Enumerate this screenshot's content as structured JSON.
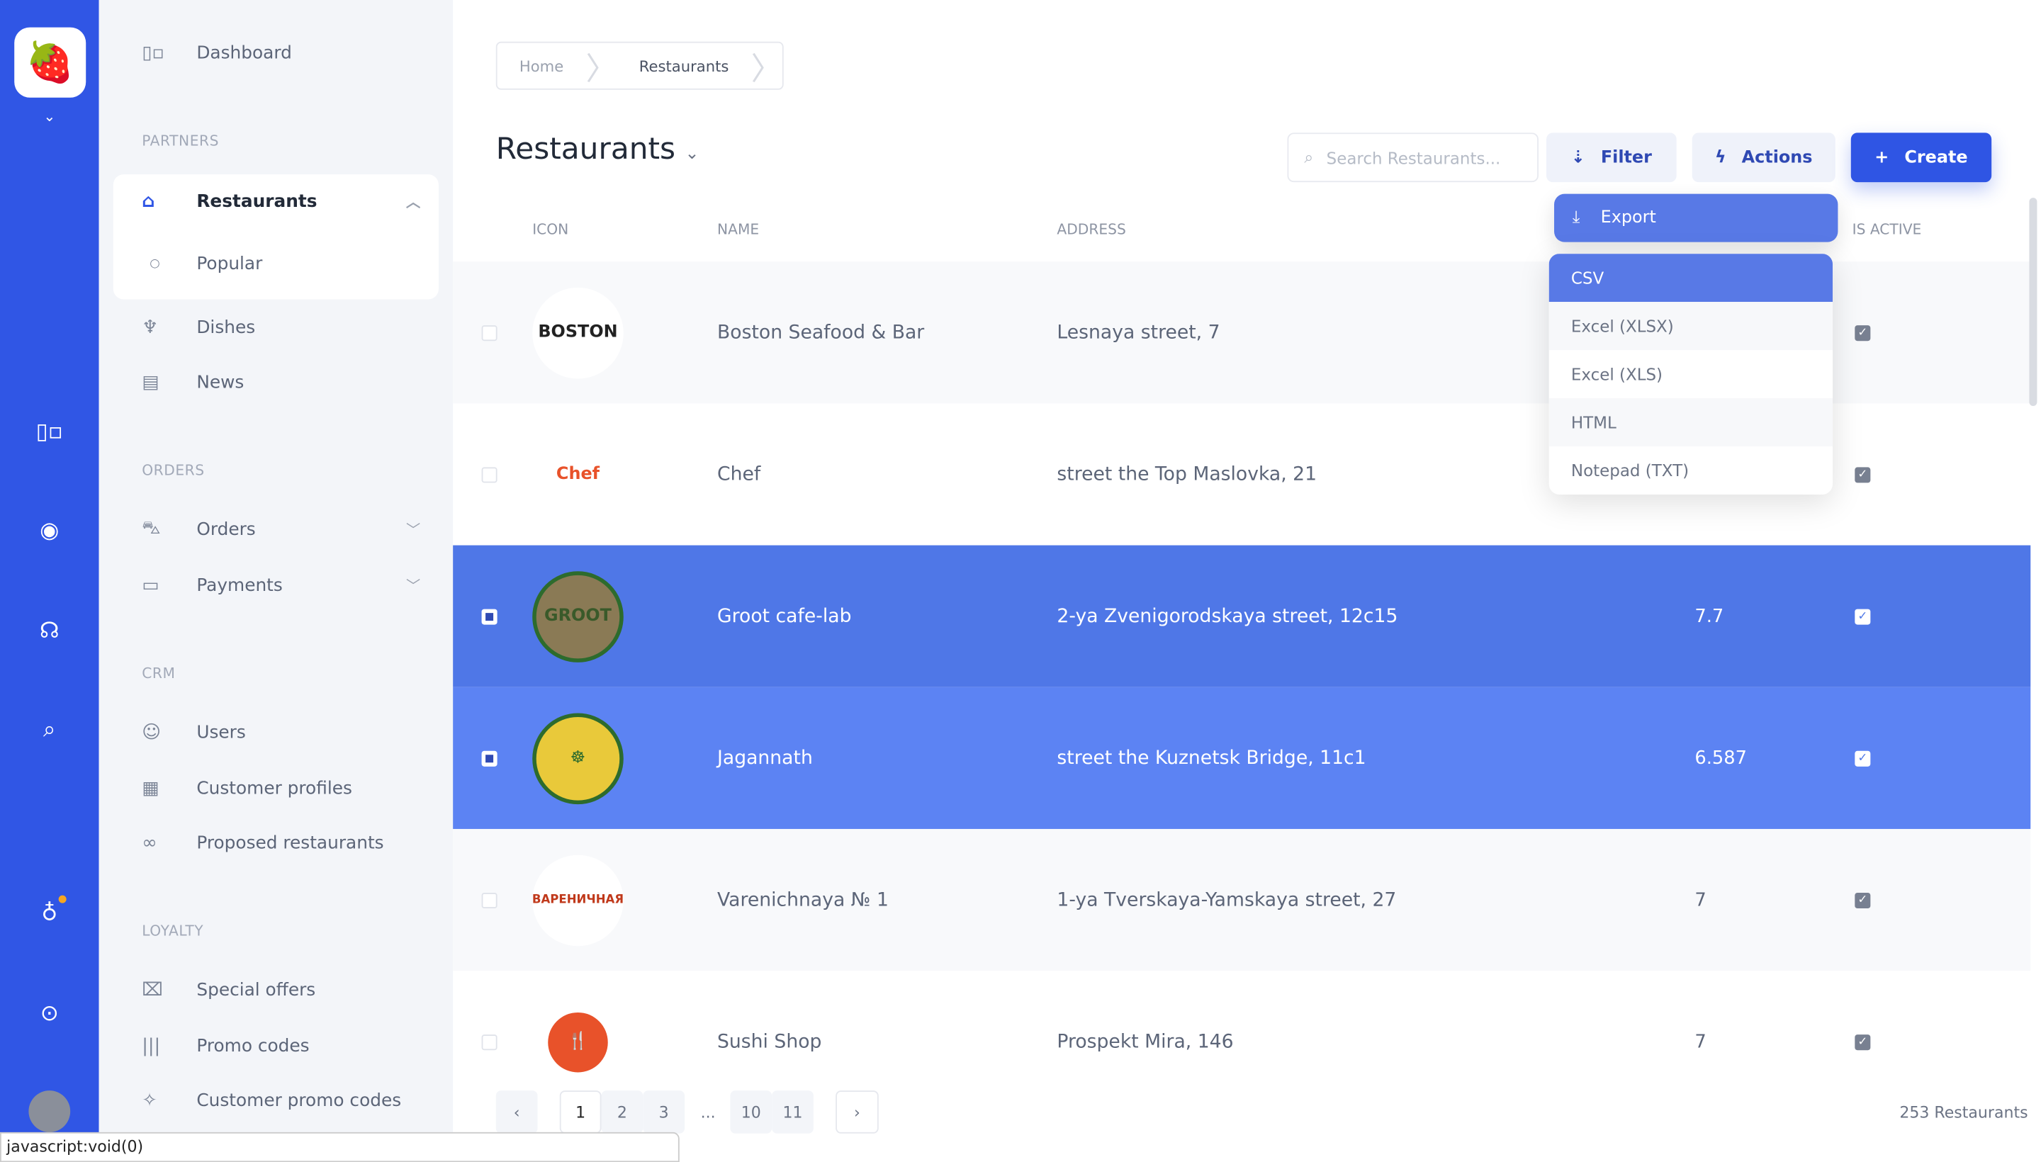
{
  "rail": {
    "icons": [
      "raspberry-logo",
      "chevron-down-icon",
      "dashboard-icon",
      "globe-icon",
      "support-icon",
      "search-icon",
      "lightbulb-icon",
      "toggle-icon",
      "avatar"
    ],
    "accent": "#3056e5",
    "notification_color": "#f5a623"
  },
  "sidebar": {
    "dashboard": "Dashboard",
    "sections": {
      "partners": "PARTNERS",
      "orders": "ORDERS",
      "crm": "CRM",
      "loyalty": "LOYALTY"
    },
    "items": [
      {
        "label": "Restaurants",
        "icon": "home-icon"
      },
      {
        "label": "Popular",
        "icon": "dot-icon"
      },
      {
        "label": "Dishes",
        "icon": "cutlery-icon"
      },
      {
        "label": "News",
        "icon": "news-icon"
      },
      {
        "label": "Orders",
        "icon": "cart-icon"
      },
      {
        "label": "Payments",
        "icon": "wallet-icon"
      },
      {
        "label": "Users",
        "icon": "users-icon"
      },
      {
        "label": "Customer profiles",
        "icon": "clipboard-icon"
      },
      {
        "label": "Proposed restaurants",
        "icon": "glasses-icon"
      },
      {
        "label": "Special offers",
        "icon": "gift-icon"
      },
      {
        "label": "Promo codes",
        "icon": "barcode-icon"
      },
      {
        "label": "Customer promo codes",
        "icon": "magic-icon"
      }
    ]
  },
  "breadcrumb": [
    "Home",
    "Restaurants"
  ],
  "header": {
    "title": "Restaurants",
    "search_placeholder": "Search Restaurants...",
    "filter": "Filter",
    "actions": "Actions",
    "create": "Create"
  },
  "table": {
    "columns": {
      "icon": "ICON",
      "name": "NAME",
      "address": "ADDRESS",
      "active": "IS ACTIVE"
    },
    "rows": [
      {
        "logo": "BOSTON",
        "name": "Boston Seafood & Bar",
        "address": "Lesnaya street, 7",
        "rating": "",
        "active": true,
        "selected": false
      },
      {
        "logo": "Chef",
        "name": "Chef",
        "address": "street the Top Maslovka, 21",
        "rating": "",
        "active": true,
        "selected": false
      },
      {
        "logo": "GROOT",
        "name": "Groot cafe-lab",
        "address": "2-ya Zvenigorodskaya street, 12c15",
        "rating": "7.7",
        "active": true,
        "selected": true
      },
      {
        "logo": "☸",
        "name": "Jagannath",
        "address": "street the Kuznetsk Bridge, 11c1",
        "rating": "6.587",
        "active": true,
        "selected": true
      },
      {
        "logo": "ВАРЕНИЧНАЯ",
        "name": "Varenichnaya № 1",
        "address": "1-ya Tverskaya-Yamskaya street, 27",
        "rating": "7",
        "active": true,
        "selected": false
      },
      {
        "logo": "🍴",
        "name": "Sushi Shop",
        "address": "Prospekt Mira, 146",
        "rating": "7",
        "active": true,
        "selected": false
      }
    ]
  },
  "dropdown": {
    "header": "Export",
    "options": [
      "CSV",
      "Excel (XLSX)",
      "Excel (XLS)",
      "HTML",
      "Notepad (TXT)"
    ],
    "highlighted": "CSV"
  },
  "pagination": {
    "prev": "‹",
    "pages": [
      "1",
      "2",
      "3",
      "...",
      "10",
      "11"
    ],
    "current": "1",
    "next": "›",
    "total": "253 Restaurants"
  },
  "statusbar": "javascript:void(0)"
}
